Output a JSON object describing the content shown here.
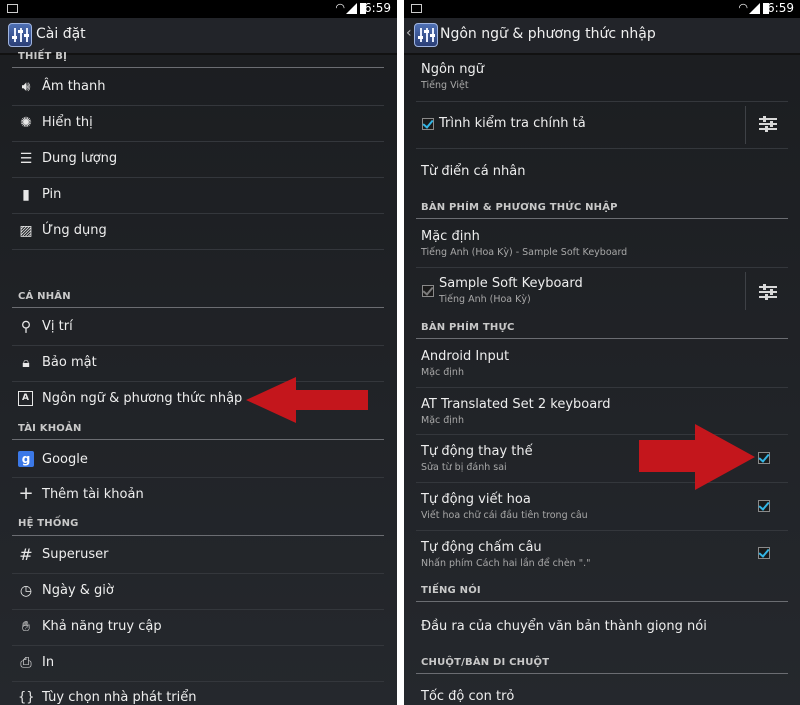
{
  "status": {
    "time": "6:59"
  },
  "left": {
    "title": "Cài đặt",
    "sections": [
      {
        "header": "THIẾT BỊ",
        "items": [
          {
            "label": "Âm thanh",
            "icon": "volume-icon"
          },
          {
            "label": "Hiển thị",
            "icon": "brightness-icon"
          },
          {
            "label": "Dung lượng",
            "icon": "storage-icon"
          },
          {
            "label": "Pin",
            "icon": "battery-icon"
          },
          {
            "label": "Ứng dụng",
            "icon": "apps-icon"
          }
        ]
      },
      {
        "header": "CÁ NHÂN",
        "items": [
          {
            "label": "Vị trí",
            "icon": "location-icon"
          },
          {
            "label": "Bảo mật",
            "icon": "lock-icon"
          },
          {
            "label": "Ngôn ngữ & phương thức nhập",
            "icon": "language-icon"
          }
        ]
      },
      {
        "header": "TÀI KHOẢN",
        "items": [
          {
            "label": "Google",
            "icon": "google-icon"
          },
          {
            "label": "Thêm tài khoản",
            "icon": "plus-icon"
          }
        ]
      },
      {
        "header": "HỆ THỐNG",
        "items": [
          {
            "label": "Superuser",
            "icon": "hash-icon"
          },
          {
            "label": "Ngày & giờ",
            "icon": "clock-icon"
          },
          {
            "label": "Khả năng truy cập",
            "icon": "hand-icon"
          },
          {
            "label": "In",
            "icon": "printer-icon"
          },
          {
            "label": "Tùy chọn nhà phát triển",
            "icon": "braces-icon"
          }
        ]
      }
    ]
  },
  "right": {
    "title": "Ngôn ngữ & phương thức nhập",
    "language": {
      "title": "Ngôn ngữ",
      "sub": "Tiếng Việt"
    },
    "spellcheck": {
      "title": "Trình kiểm tra chính tả",
      "checked": true
    },
    "dictionary": {
      "title": "Từ điển cá nhân"
    },
    "keyboard_header": "BÀN PHÍM & PHƯƠNG THỨC NHẬP",
    "default_kb": {
      "title": "Mặc định",
      "sub": "Tiếng Anh (Hoa Kỳ) - Sample Soft Keyboard"
    },
    "soft_kb": {
      "title": "Sample Soft Keyboard",
      "sub": "Tiếng Anh (Hoa Kỳ)",
      "checked": true
    },
    "physical_header": "BÀN PHÍM THỰC",
    "android_input": {
      "title": "Android Input",
      "sub": "Mặc định"
    },
    "at_kb": {
      "title": "AT Translated Set 2 keyboard",
      "sub": "Mặc định"
    },
    "auto_replace": {
      "title": "Tự động thay thế",
      "sub": "Sửa từ bị đánh sai",
      "checked": true
    },
    "auto_caps": {
      "title": "Tự động viết hoa",
      "sub": "Viết hoa chữ cái đầu tiên trong câu",
      "checked": true
    },
    "auto_punct": {
      "title": "Tự động chấm câu",
      "sub": "Nhấn phím Cách hai lần để chèn \".\"",
      "checked": true
    },
    "speech_header": "TIẾNG NÓI",
    "tts": {
      "title": "Đầu ra của chuyển văn bản thành giọng nói"
    },
    "mouse_header": "CHUỘT/BÀN DI CHUỘT",
    "pointer_speed": {
      "title": "Tốc độ con trỏ"
    }
  },
  "colors": {
    "accent": "#33b5e5",
    "arrow": "#c4161c",
    "background": "#1e2024"
  }
}
